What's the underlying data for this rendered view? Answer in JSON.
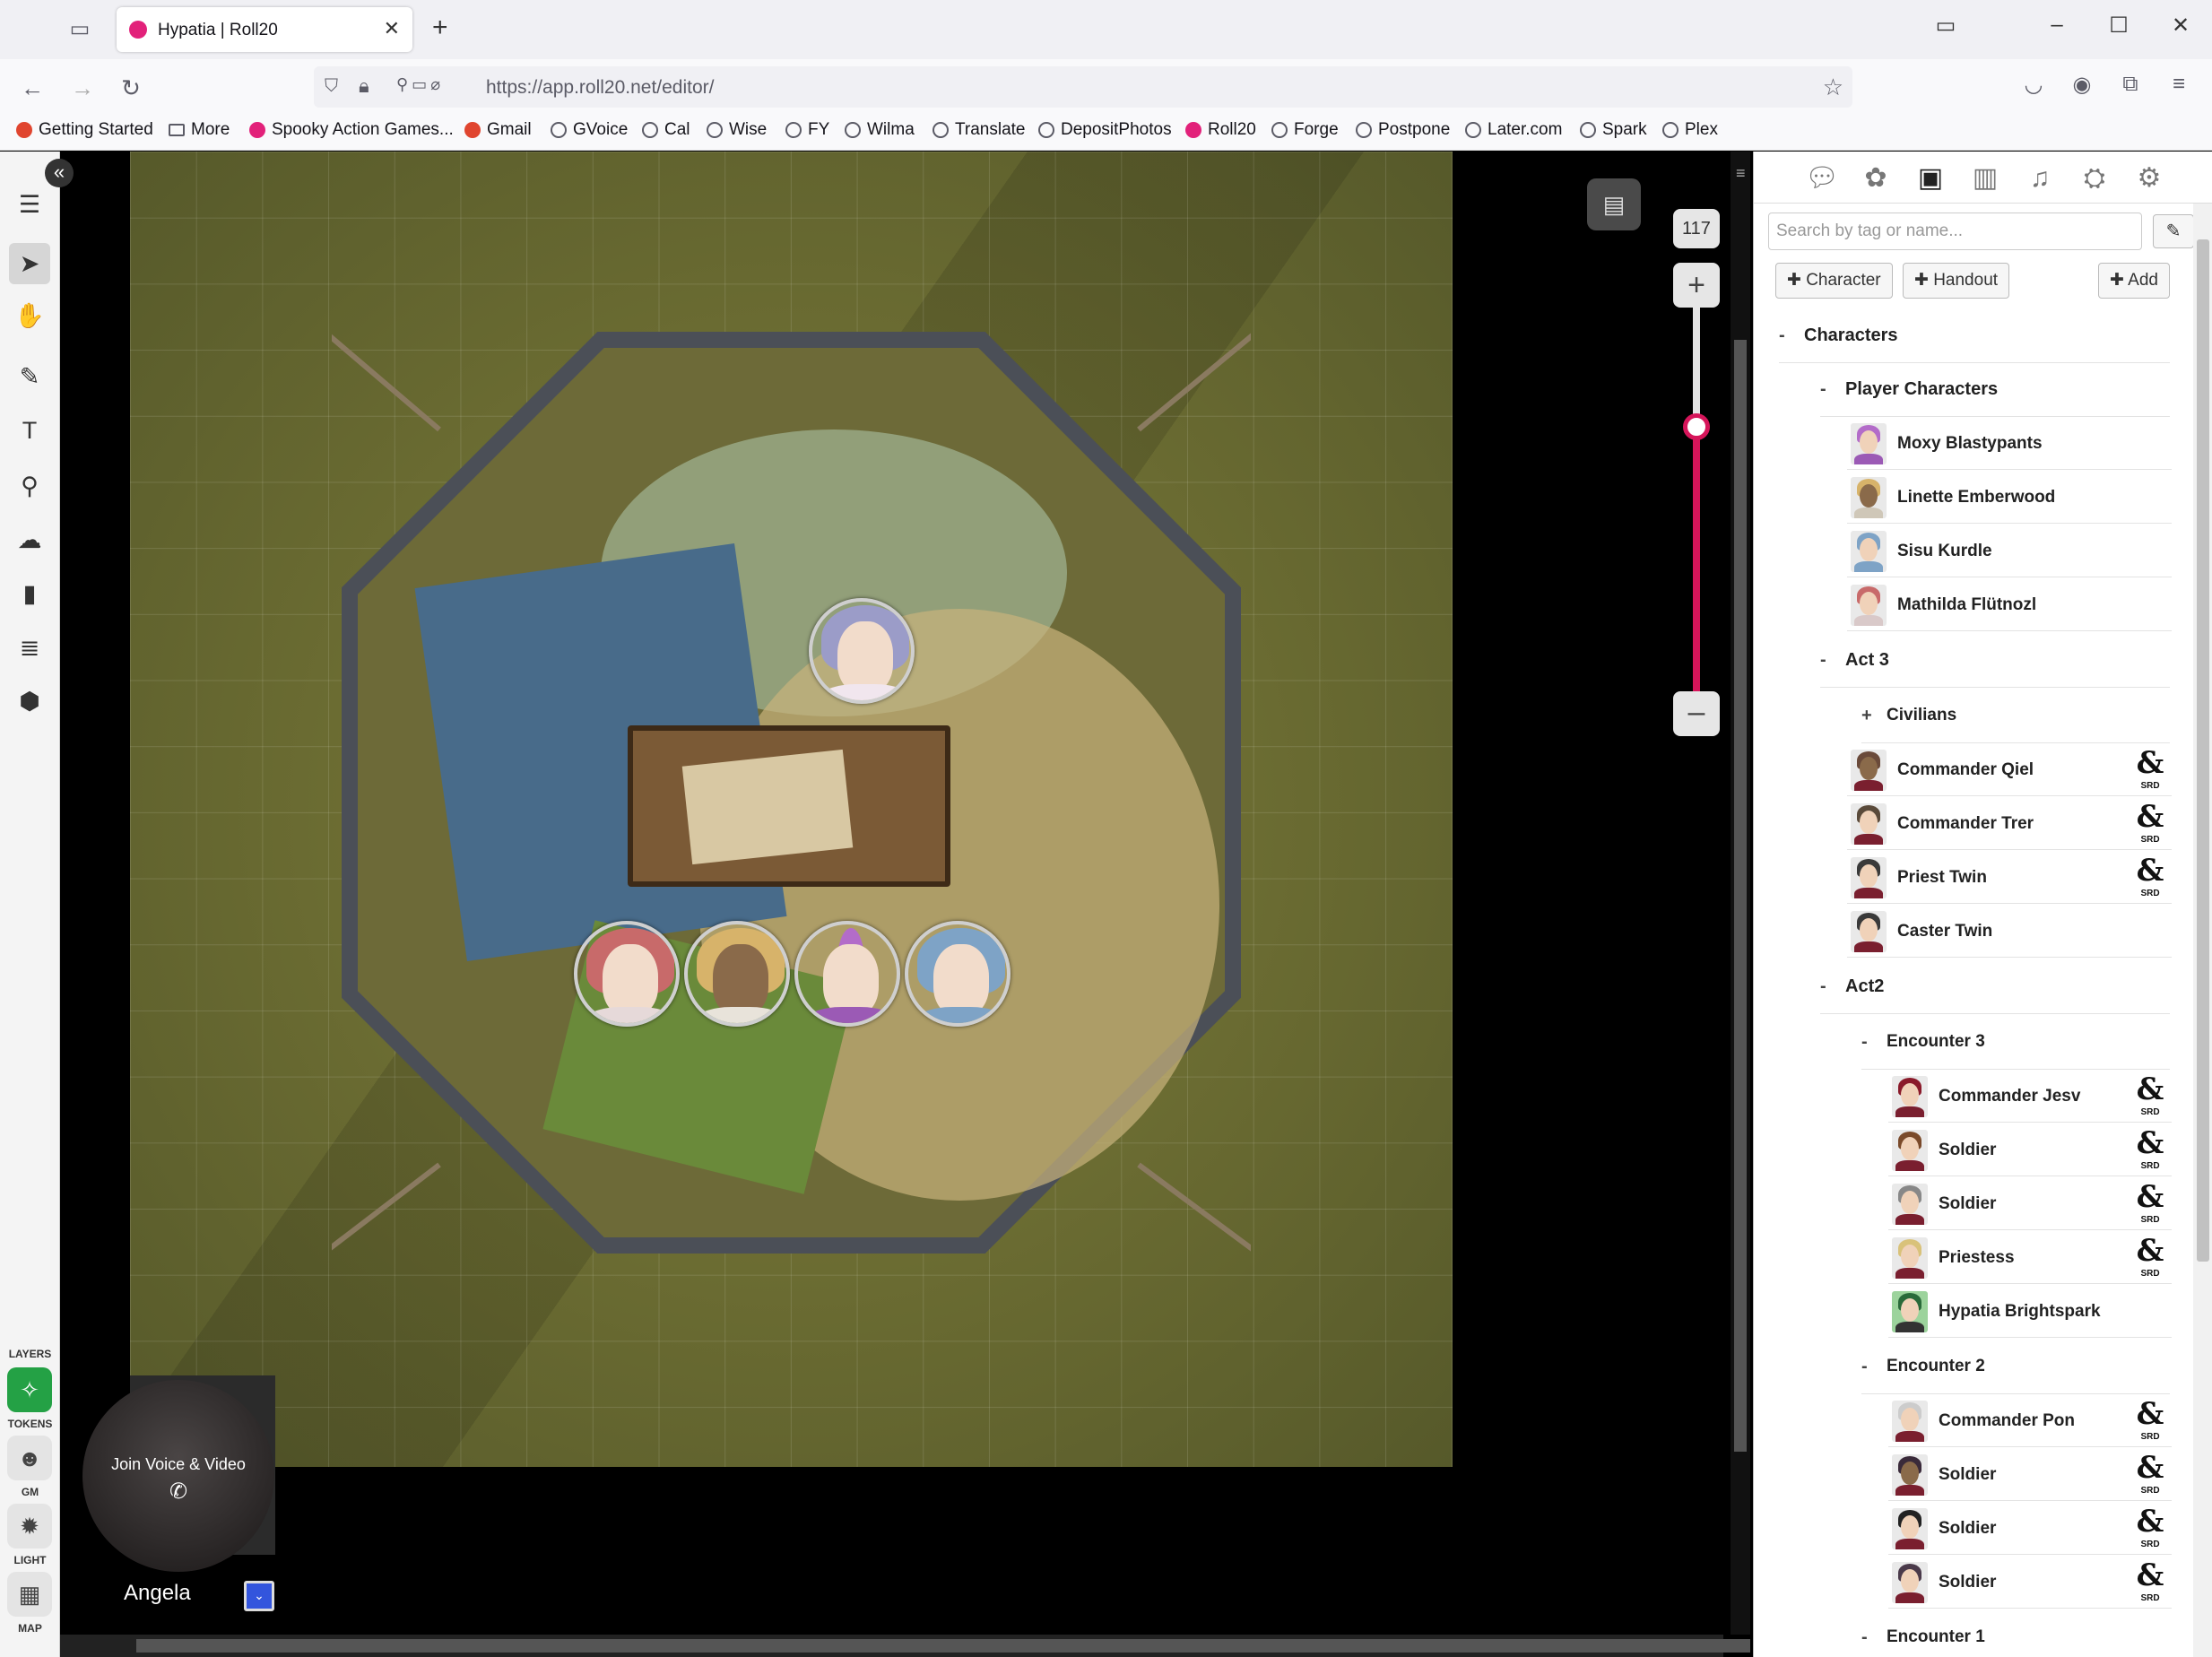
{
  "browser": {
    "tab_title": "Hypatia | Roll20",
    "url": "https://app.roll20.net/editor/",
    "bookmarks": [
      "Getting Started",
      "More",
      "Spooky Action Games...",
      "Gmail",
      "GVoice",
      "Cal",
      "Wise",
      "FY",
      "Wilma",
      "Translate",
      "DepositPhotos",
      "Roll20",
      "Forge",
      "Postpone",
      "Later.com",
      "Spark",
      "Plex"
    ]
  },
  "toolbar": {
    "layers_label": "LAYERS",
    "tokens_label": "TOKENS",
    "gm_label": "GM",
    "light_label": "LIGHT",
    "map_label": "MAP"
  },
  "video": {
    "join_text": "Join Voice & Video",
    "player_name": "Angela"
  },
  "zoom": {
    "value": "117",
    "slider_level_pct": 68
  },
  "sidebar": {
    "search_placeholder": "Search by tag or name...",
    "character_btn": "Character",
    "handout_btn": "Handout",
    "add_btn": "Add",
    "root_folder": "Characters",
    "player_folder": "Player Characters",
    "players": [
      "Moxy Blastypants",
      "Linette Emberwood",
      "Sisu Kurdle",
      "Mathilda Flütnozl"
    ],
    "act3_folder": "Act 3",
    "civilians_folder": "Civilians",
    "act3": [
      "Commander Qiel",
      "Commander Trer",
      "Priest Twin",
      "Caster Twin"
    ],
    "act2_folder": "Act2",
    "enc3_folder": "Encounter 3",
    "enc3": [
      "Commander Jesv",
      "Soldier",
      "Soldier",
      "Priestess",
      "Hypatia Brightspark"
    ],
    "enc2_folder": "Encounter 2",
    "enc2": [
      "Commander Pon",
      "Soldier",
      "Soldier",
      "Soldier"
    ],
    "enc1_folder": "Encounter 1",
    "srd_mark": "&",
    "srd_label": "SRD"
  },
  "colors": {
    "accent": "#d6155a",
    "layer_active": "#24a145",
    "player_color": "#3355dd"
  }
}
